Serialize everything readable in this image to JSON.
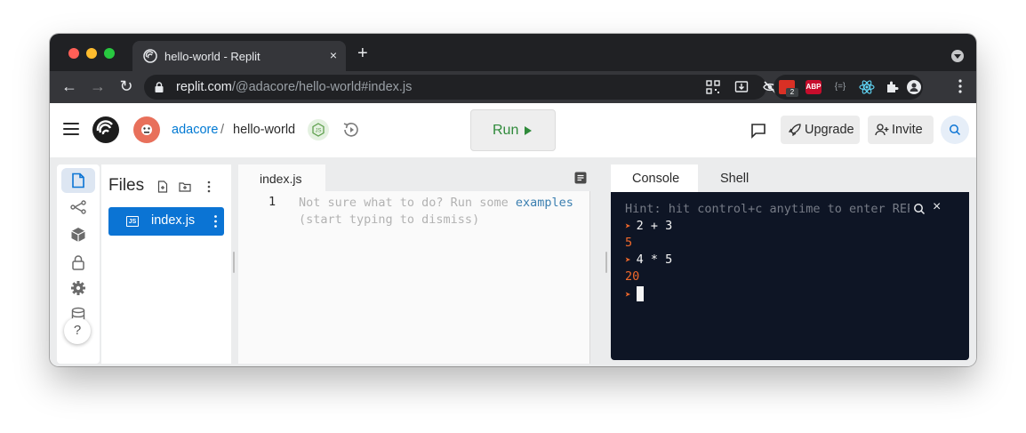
{
  "browser": {
    "tab_title": "hello-world - Replit",
    "tab_close": "×",
    "new_tab": "+",
    "url_domain": "replit.com",
    "url_path": "/@adacore/hello-world#index.js",
    "extension_badge_count": "2",
    "extension_abp": "ABP"
  },
  "header": {
    "user": "adacore",
    "separator": "/",
    "repl_name": "hello-world",
    "run_label": "Run",
    "upgrade_label": "Upgrade",
    "invite_label": "Invite"
  },
  "files": {
    "title": "Files",
    "items": [
      {
        "name": "index.js",
        "type_badge": "JS"
      }
    ]
  },
  "help_label": "?",
  "editor": {
    "tab_label": "index.js",
    "line_number": "1",
    "hint_line1": "Not sure what to do? Run some ",
    "hint_link": "examples",
    "hint_line2": "(start typing to dismiss)"
  },
  "panel": {
    "tabs": [
      {
        "label": "Console",
        "active": true
      },
      {
        "label": "Shell",
        "active": false
      }
    ],
    "hint": "Hint: hit control+c anytime to enter REPL.",
    "close": "×",
    "lines": [
      {
        "kind": "input",
        "text": "2 + 3"
      },
      {
        "kind": "output",
        "text": "5"
      },
      {
        "kind": "input",
        "text": "4 * 5"
      },
      {
        "kind": "output",
        "text": "20"
      }
    ]
  },
  "colors": {
    "accent_blue": "#0b74d4",
    "run_green": "#2f8a3a",
    "console_bg": "#0e1525",
    "console_orange": "#f0682b"
  }
}
